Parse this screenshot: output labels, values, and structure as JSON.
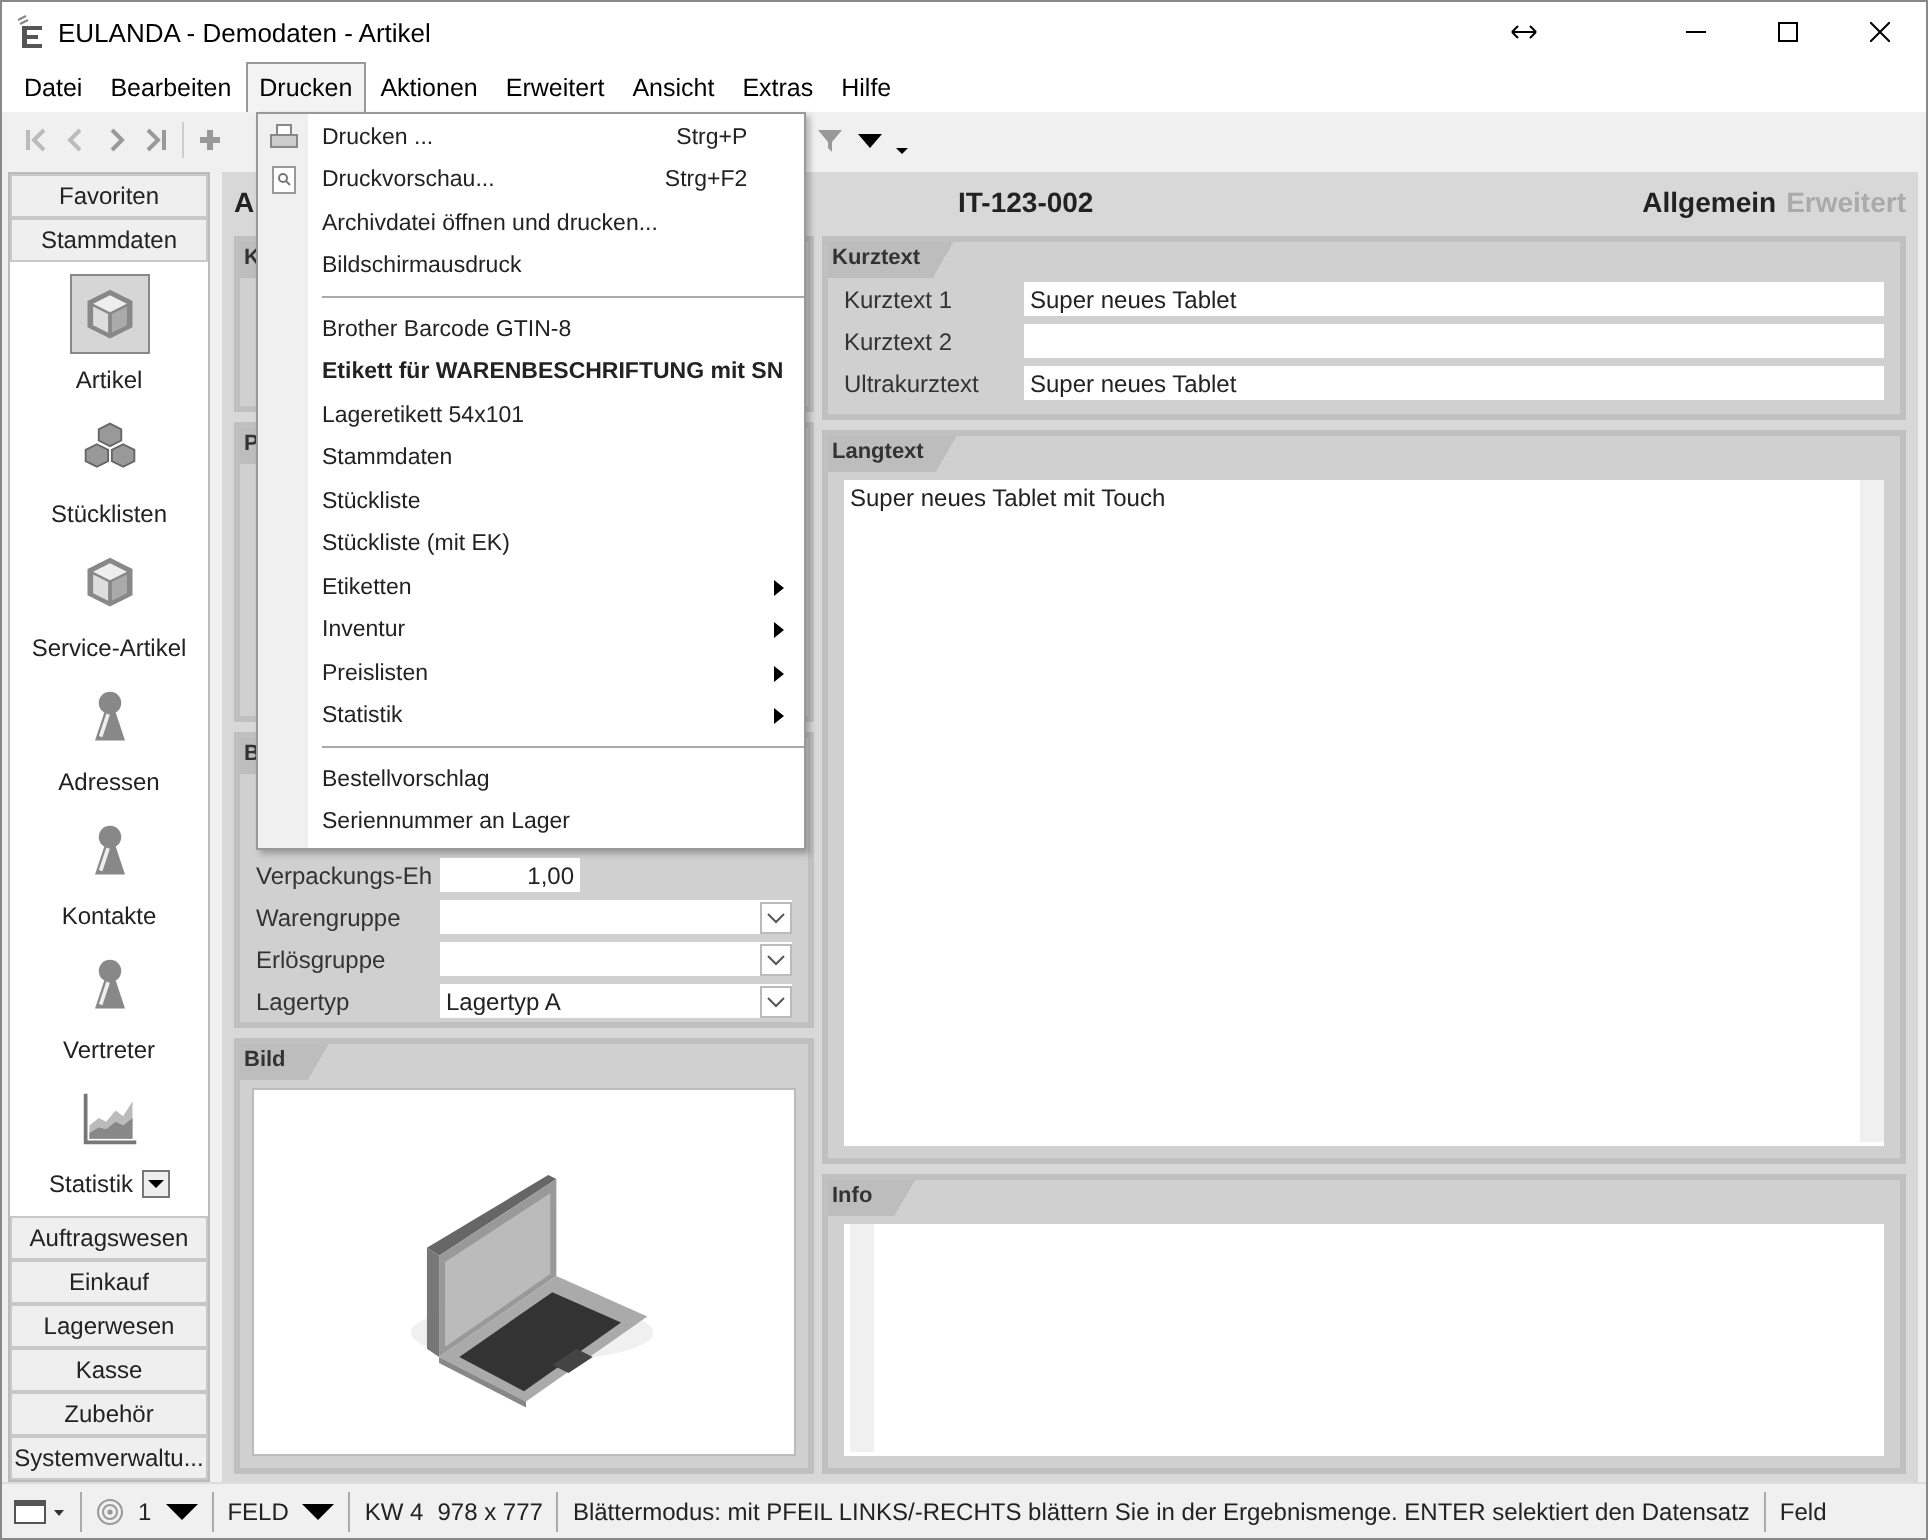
{
  "window": {
    "title": "EULANDA - Demodaten - Artikel"
  },
  "menubar": [
    {
      "label": "Datei",
      "selected": false
    },
    {
      "label": "Bearbeiten",
      "selected": false
    },
    {
      "label": "Drucken",
      "selected": true
    },
    {
      "label": "Aktionen",
      "selected": false
    },
    {
      "label": "Erweitert",
      "selected": false
    },
    {
      "label": "Ansicht",
      "selected": false
    },
    {
      "label": "Extras",
      "selected": false
    },
    {
      "label": "Hilfe",
      "selected": false
    }
  ],
  "dropdown": [
    {
      "kind": "item",
      "label": "Drucken ...",
      "shortcut": "Strg+P"
    },
    {
      "kind": "item",
      "label": "Druckvorschau...",
      "shortcut": "Strg+F2"
    },
    {
      "kind": "item",
      "label": "Archivdatei öffnen und drucken..."
    },
    {
      "kind": "item",
      "label": "Bildschirmausdruck"
    },
    {
      "kind": "separator"
    },
    {
      "kind": "item",
      "label": "Brother Barcode GTIN-8"
    },
    {
      "kind": "item",
      "label": "Etikett für WARENBESCHRIFTUNG mit SN",
      "default": true
    },
    {
      "kind": "item",
      "label": "Lageretikett 54x101"
    },
    {
      "kind": "item",
      "label": "Stammdaten"
    },
    {
      "kind": "item",
      "label": "Stückliste"
    },
    {
      "kind": "item",
      "label": "Stückliste (mit EK)"
    },
    {
      "kind": "submenu",
      "label": "Etiketten"
    },
    {
      "kind": "submenu",
      "label": "Inventur"
    },
    {
      "kind": "submenu",
      "label": "Preislisten"
    },
    {
      "kind": "submenu",
      "label": "Statistik"
    },
    {
      "kind": "separator"
    },
    {
      "kind": "item",
      "label": "Bestellvorschlag"
    },
    {
      "kind": "item",
      "label": "Seriennummer an Lager"
    }
  ],
  "sidebar": {
    "top_buttons": [
      "Favoriten",
      "Stammdaten"
    ],
    "items": [
      {
        "label": "Artikel",
        "kind": "cube",
        "selected": true
      },
      {
        "label": "Stücklisten",
        "kind": "cubes",
        "selected": false
      },
      {
        "label": "Service-Artikel",
        "kind": "cube",
        "selected": false
      },
      {
        "label": "Adressen",
        "kind": "person",
        "selected": false
      },
      {
        "label": "Kontakte",
        "kind": "person",
        "selected": false
      },
      {
        "label": "Vertreter",
        "kind": "person",
        "selected": false
      },
      {
        "label": "Statistik",
        "kind": "chart",
        "selected": false,
        "dropdown": true
      }
    ],
    "bottom_buttons": [
      "Auftragswesen",
      "Einkauf",
      "Lagerwesen",
      "Kasse",
      "Zubehör",
      "Systemverwaltu..."
    ]
  },
  "header": {
    "title_fragment": "A",
    "article_number": "IT-123-002",
    "tabs": [
      {
        "label": "Allgemein",
        "selected": true
      },
      {
        "label": "Erweitert",
        "selected": false
      }
    ]
  },
  "left_groups": [
    {
      "title": "K"
    },
    {
      "title": "P"
    },
    {
      "title": "B",
      "rows": [
        {
          "label": "Verpackungs-Eh",
          "value": "1,00",
          "kind": "number"
        },
        {
          "label": "Warengruppe",
          "kind": "combo"
        },
        {
          "label": "Erlösgruppe",
          "kind": "combo"
        },
        {
          "label": "Lagertyp",
          "value": "Lagertyp A",
          "kind": "combo"
        }
      ]
    }
  ],
  "bild": {
    "title": "Bild",
    "kind": "picture"
  },
  "kurztext": {
    "title": "Kurztext",
    "rows": [
      {
        "label": "Kurztext 1",
        "value": "Super neues Tablet"
      },
      {
        "label": "Kurztext 2"
      },
      {
        "label": "Ultrakurztext",
        "value": "Super neues Tablet"
      }
    ]
  },
  "langtext": {
    "title": "Langtext",
    "value": "Super neues Tablet mit Touch"
  },
  "info": {
    "title": "Info"
  },
  "status_bar": {
    "page": "1",
    "mode": "FELD",
    "week": "KW 4",
    "size": "978 x 777",
    "message": "Blättermodus: mit PFEIL LINKS/-RECHTS blättern Sie in der Ergebnismenge. ENTER selektiert den Datensatz",
    "field": "Feld"
  }
}
